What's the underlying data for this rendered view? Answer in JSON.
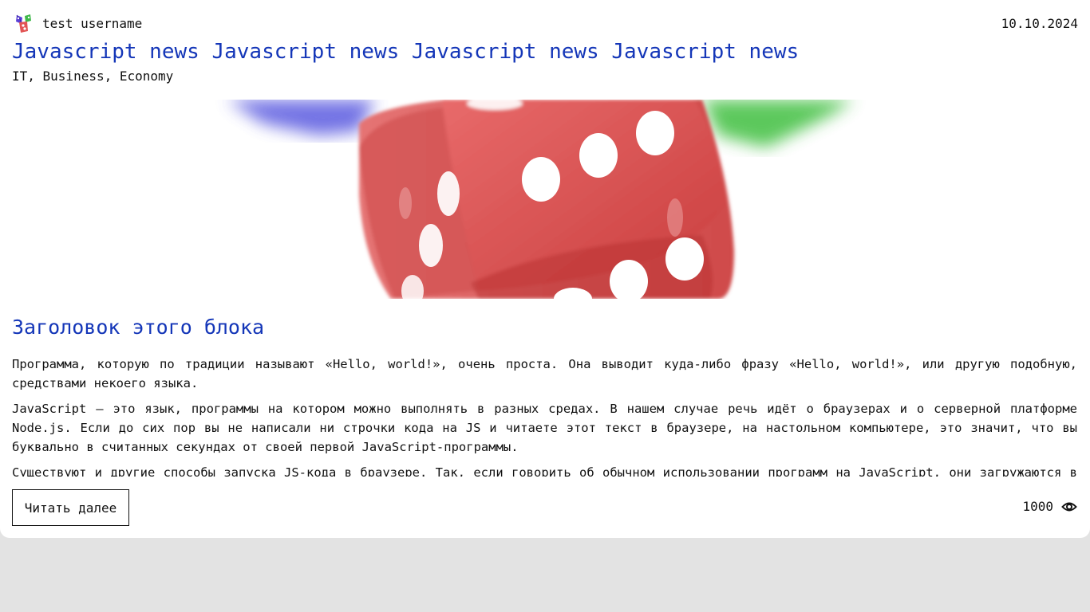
{
  "post": {
    "author": "test username",
    "date": "10.10.2024",
    "title": "Javascript news Javascript news Javascript news Javascript news",
    "tags": "IT, Business, Economy",
    "hero_image": "red-dice-image",
    "block_title": "Заголовок этого блока",
    "paragraphs": [
      "Программа, которую по традиции называют «Hello, world!», очень проста. Она выводит куда-либо фразу «Hello, world!», или другую подобную, средствами некоего языка.",
      "JavaScript — это язык, программы на котором можно выполнять в разных средах. В нашем случае речь идёт о браузерах и о серверной платформе Node.js. Если до сих пор вы не написали ни строчки кода на JS и читаете этот текст в браузере, на настольном компьютере, это значит, что вы буквально в считанных секундах от своей первой JavaScript-программы.",
      "Существуют и другие способы запуска JS-кода в браузере. Так, если говорить об обычном использовании программ на JavaScript, они загружаются в браузер для обеспечения работы веб-страниц."
    ],
    "read_more_label": "Читать далее",
    "views": "1000",
    "views_icon": "eye-icon"
  }
}
